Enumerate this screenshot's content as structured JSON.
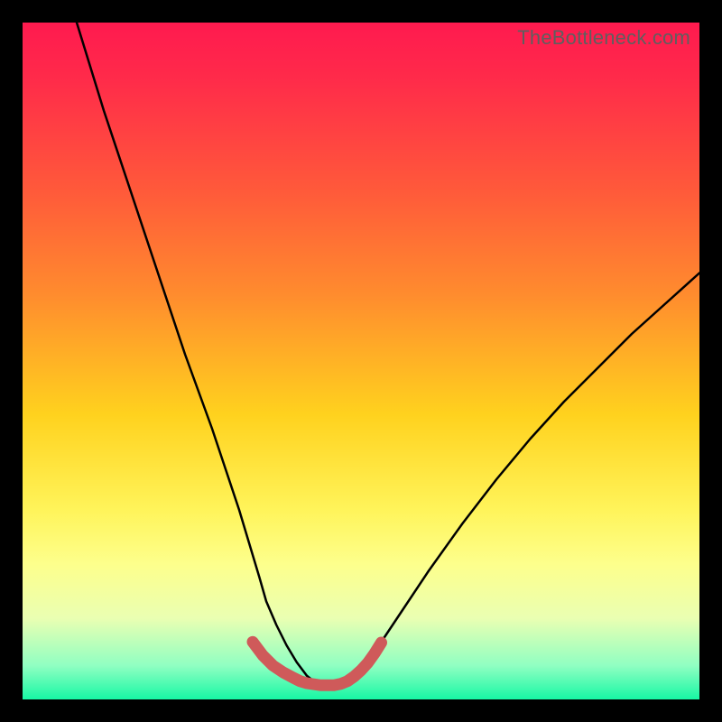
{
  "watermark": "TheBottleneck.com",
  "chart_data": {
    "type": "line",
    "title": "",
    "xlabel": "",
    "ylabel": "",
    "xlim": [
      0,
      100
    ],
    "ylim": [
      0,
      100
    ],
    "series": [
      {
        "name": "left-curve",
        "x": [
          8,
          12,
          16,
          20,
          24,
          28,
          30,
          32,
          33.5,
          35,
          36,
          37.5,
          39,
          40.5,
          42,
          43.5,
          45
        ],
        "values": [
          100,
          87,
          75,
          63,
          51,
          40,
          34,
          28,
          23,
          18,
          14.5,
          11,
          8,
          5.5,
          3.5,
          2.3,
          2
        ],
        "color": "#000000",
        "stroke_width": 2.5
      },
      {
        "name": "right-curve",
        "x": [
          45,
          47,
          49,
          51,
          53,
          56,
          60,
          65,
          70,
          75,
          80,
          85,
          90,
          95,
          100
        ],
        "values": [
          2,
          2.3,
          3.2,
          5.5,
          8.5,
          13,
          19,
          26,
          32.5,
          38.5,
          44,
          49,
          54,
          58.5,
          63
        ],
        "color": "#000000",
        "stroke_width": 2.5
      },
      {
        "name": "bottom-highlight",
        "x": [
          34,
          35.5,
          37,
          38.5,
          40,
          41,
          42,
          44,
          46,
          47,
          48,
          49,
          50,
          51,
          52,
          53
        ],
        "values": [
          8.5,
          6.5,
          5,
          4,
          3.2,
          2.7,
          2.4,
          2.1,
          2.1,
          2.3,
          2.7,
          3.4,
          4.3,
          5.4,
          6.8,
          8.4
        ],
        "color": "#cf5a5a",
        "stroke_width": 13
      }
    ]
  }
}
